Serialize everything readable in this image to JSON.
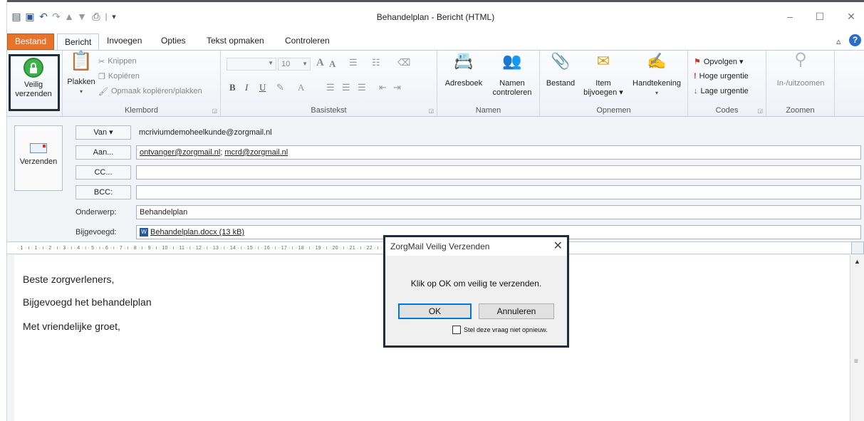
{
  "window": {
    "title": "Behandelplan  -  Bericht (HTML)",
    "controls": {
      "minimize": "–",
      "maximize": "☐",
      "close": "✕"
    }
  },
  "quick_access": {
    "separator": "|",
    "customize": "▾"
  },
  "tabs": [
    {
      "label": "Bestand",
      "type": "file"
    },
    {
      "label": "Bericht",
      "type": "active"
    },
    {
      "label": "Invoegen"
    },
    {
      "label": "Opties"
    },
    {
      "label": "Tekst opmaken"
    },
    {
      "label": "Controleren"
    }
  ],
  "ribbon_right_icons": {
    "collapse": "▵",
    "help": "?"
  },
  "ribbon": {
    "secure_send": {
      "line1": "Veilig",
      "line2": "verzenden"
    },
    "clipboard": {
      "paste": "Plakken",
      "paste_dropdown": "▾",
      "cut": "Knippen",
      "copy": "Kopiëren",
      "format_painter": "Opmaak kopiëren/plakken",
      "group": "Klembord"
    },
    "basic_text": {
      "font_size": "10",
      "bold": "B",
      "italic": "I",
      "underline": "U",
      "group": "Basistekst"
    },
    "names": {
      "address_book": "Adresboek",
      "check_names_1": "Namen",
      "check_names_2": "controleren",
      "group": "Namen"
    },
    "include": {
      "file": "Bestand",
      "item_1": "Item",
      "item_2": "bijvoegen ▾",
      "signature": "Handtekening",
      "signature_dropdown": "▾",
      "group": "Opnemen"
    },
    "tags": {
      "follow_up": "Opvolgen ▾",
      "high": "Hoge urgentie",
      "low": "Lage urgentie",
      "group": "Codes"
    },
    "zoom": {
      "zoom": "In-/uitzoomen",
      "group": "Zoomen"
    }
  },
  "compose": {
    "send_button": "Verzenden",
    "from_button": "Van ▾",
    "from_value": "mcriviumdemoheelkunde@zorgmail.nl",
    "to_button": "Aan...",
    "to_recipient_1": "ontvanger@zorgmail.nl",
    "to_separator": ";",
    "to_recipient_2": "mcrd@zorgmail.nl",
    "cc_button": "CC...",
    "cc_value": "",
    "bcc_button": "BCC:",
    "bcc_value": "",
    "subject_label": "Onderwerp:",
    "subject_value": "Behandelplan",
    "attached_label": "Bijgevoegd:",
    "attachment": "Behandelplan.docx (13 kB)"
  },
  "ruler": {
    "text": "· 1 · ı · 1 · ı · 2 · ı · 3 · ı · 4 · ı · 5 · ı · 6 · ı · 7 · ı · 8 · ı · 9 · ı · 10 · ı · 11 · ı · 12 · ı · 13 · ı · 14 · ı · 15 · ı · 16 · ı · 17 · ı · 18 · ı · 19 · ı · 20 · ı · 21 · ı · 22 · ı · 23 · ı · 24 · ı · 25 · ı · 26 · ı · 27 · ı · 28 · ı"
  },
  "body": {
    "line1": "Beste zorgverleners,",
    "line2": "Bijgevoegd het behandelplan",
    "line3": "Met vriendelijke groet,"
  },
  "dialog": {
    "title": "ZorgMail Veilig Verzenden",
    "close": "✕",
    "message": "Klik op OK om veilig te verzenden.",
    "ok": "OK",
    "cancel": "Annuleren",
    "checkbox_label": "Stel deze vraag niet opnieuw."
  },
  "colors": {
    "file_tab": "#e8732a",
    "lock_green": "#3bb34a",
    "highlight_border": "#1f2d3d",
    "follow_up_flag": "#c0392b",
    "high_importance": "#d9302b",
    "low_importance": "#2a5fb8"
  }
}
